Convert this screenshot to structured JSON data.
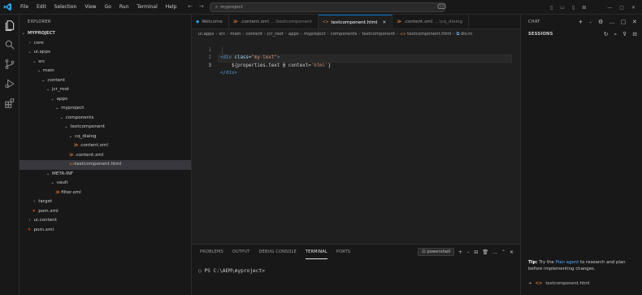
{
  "titlebar": {
    "menu": [
      "File",
      "Edit",
      "Selection",
      "View",
      "Go",
      "Run",
      "Terminal",
      "Help"
    ],
    "search": "myproject"
  },
  "explorer": {
    "title": "EXPLORER",
    "root": "MYPROJECT",
    "items": [
      {
        "label": "core",
        "depth": 1,
        "kind": "folder",
        "open": false
      },
      {
        "label": "ui.apps",
        "depth": 1,
        "kind": "folder",
        "open": true
      },
      {
        "label": "src",
        "depth": 2,
        "kind": "folder",
        "open": true
      },
      {
        "label": "main",
        "depth": 3,
        "kind": "folder",
        "open": true
      },
      {
        "label": "content",
        "depth": 4,
        "kind": "folder",
        "open": true
      },
      {
        "label": "jcr_root",
        "depth": 5,
        "kind": "folder",
        "open": true
      },
      {
        "label": "apps",
        "depth": 6,
        "kind": "folder",
        "open": true
      },
      {
        "label": "myproject",
        "depth": 7,
        "kind": "folder",
        "open": true
      },
      {
        "label": "components",
        "depth": 8,
        "kind": "folder",
        "open": true
      },
      {
        "label": "textcomponent",
        "depth": 9,
        "kind": "folder",
        "open": true
      },
      {
        "label": "cq_dialog",
        "depth": 10,
        "kind": "folder",
        "open": true
      },
      {
        "label": ".content.xml",
        "depth": 11,
        "kind": "xml"
      },
      {
        "label": ".content.xml",
        "depth": 10,
        "kind": "xml"
      },
      {
        "label": "textcomponent.html",
        "depth": 10,
        "kind": "html",
        "selected": true
      },
      {
        "label": "META-INF",
        "depth": 5,
        "kind": "folder",
        "open": true
      },
      {
        "label": "vault",
        "depth": 6,
        "kind": "folder",
        "open": true
      },
      {
        "label": "filter.xml",
        "depth": 7,
        "kind": "xml"
      },
      {
        "label": "target",
        "depth": 2,
        "kind": "folder",
        "open": false
      },
      {
        "label": "pom.xml",
        "depth": 2,
        "kind": "maven"
      },
      {
        "label": "ui.content",
        "depth": 1,
        "kind": "folder",
        "open": false
      },
      {
        "label": "pom.xml",
        "depth": 1,
        "kind": "maven"
      }
    ]
  },
  "tabs": [
    {
      "icon": "vscode",
      "label": "Welcome",
      "dim": ""
    },
    {
      "icon": "xml",
      "label": ".content.xml",
      "dim": "...\\textcomponent"
    },
    {
      "icon": "html",
      "label": "textcomponent.html",
      "dim": "",
      "active": true
    },
    {
      "icon": "xml",
      "label": ".content.xml",
      "dim": "...\\cq_dialog"
    }
  ],
  "breadcrumb": [
    "ui.apps",
    "src",
    "main",
    "content",
    "jcr_root",
    "apps",
    "myproject",
    "components",
    "textcomponent",
    "textcomponent.html",
    "div.m"
  ],
  "editor": {
    "line_numbers": [
      "1",
      "2",
      "3"
    ],
    "line1": {
      "open": "<div",
      "attr": " class=",
      "val": "\"my-text\"",
      "close": ">"
    },
    "line2": {
      "text": "    ${properties.text @ context=",
      "val": "'html'",
      "end": "}"
    },
    "line3": {
      "tag": "</div>"
    }
  },
  "panel": {
    "tabs": [
      "PROBLEMS",
      "OUTPUT",
      "DEBUG CONSOLE",
      "TERMINAL",
      "PORTS"
    ],
    "active_tab": "TERMINAL",
    "terminal_name": "powershell",
    "prompt": "PS C:\\AEM\\myproject> "
  },
  "chat": {
    "title": "CHAT",
    "sessions": "SESSIONS",
    "tip_prefix": "Tip:",
    "tip_text_1": " Try the ",
    "tip_link": "Plan agent",
    "tip_text_2": " to research and plan before implementing changes.",
    "file": "textcomponent.html"
  },
  "colors": {
    "accent": "#0078d4",
    "html_icon": "#e37933",
    "xml_icon": "#e37933",
    "maven_icon": "#e34c26"
  }
}
